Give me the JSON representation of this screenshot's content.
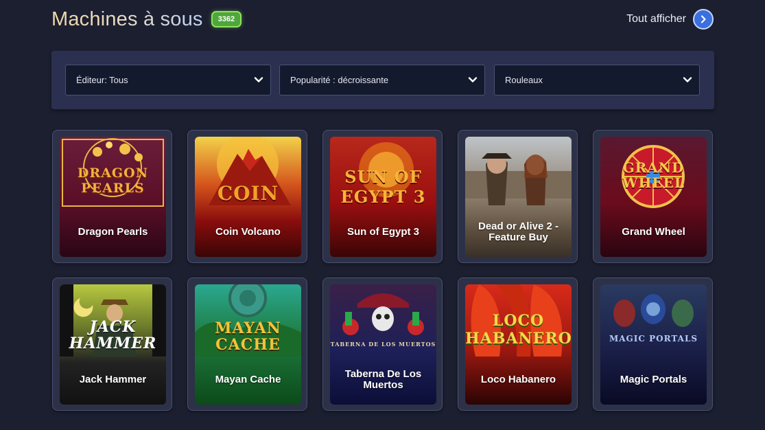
{
  "header": {
    "title": "Machines à sous",
    "count": "3362",
    "show_all_label": "Tout afficher"
  },
  "filters": [
    {
      "label": "Éditeur: Tous"
    },
    {
      "label": "Popularité : décroissante"
    },
    {
      "label": "Rouleaux"
    }
  ],
  "games": [
    {
      "name": "Dragon Pearls",
      "logo": "DRAGON PEARLS"
    },
    {
      "name": "Coin Volcano",
      "logo": "COIN"
    },
    {
      "name": "Sun of Egypt 3",
      "logo": "SUN OF EGYPT 3"
    },
    {
      "name": "Dead or Alive 2 - Feature Buy",
      "logo": ""
    },
    {
      "name": "Grand Wheel",
      "logo": "GRAND WHEEL"
    },
    {
      "name": "Jack Hammer",
      "logo": "JACK HAMMER"
    },
    {
      "name": "Mayan Cache",
      "logo": "MAYAN CACHE"
    },
    {
      "name": "Taberna De Los Muertos",
      "logo": "TABERNA DE LOS MUERTOS"
    },
    {
      "name": "Loco Habanero",
      "logo": "LOCO HABANERO"
    },
    {
      "name": "Magic Portals",
      "logo": "MAGIC PORTALS"
    }
  ],
  "colors": {
    "background": "#1c1f30",
    "filter_bar": "#2b3050",
    "badge": "#4fa63a",
    "accent": "#3a6fe0"
  },
  "icons": {
    "show_all": "chevron-right-icon",
    "dropdown": "chevron-down-icon"
  }
}
